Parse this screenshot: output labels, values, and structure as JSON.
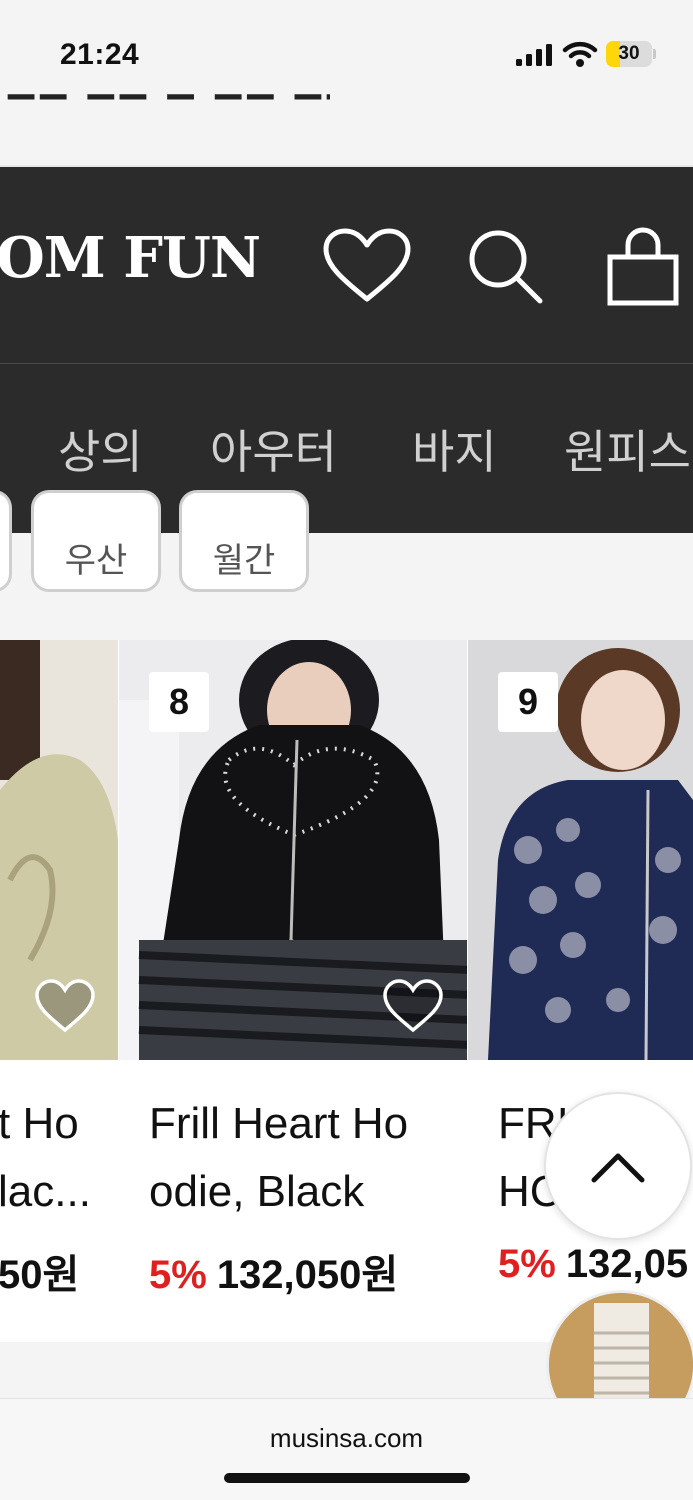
{
  "status_bar": {
    "time": "21:24",
    "battery_level": "30",
    "battery_fraction": 0.3,
    "icons": [
      "signal-icon",
      "wifi-icon",
      "battery-icon"
    ]
  },
  "header": {
    "brand": "OM FUN",
    "icons": [
      "heart-icon",
      "search-icon",
      "shopping-bag-icon"
    ]
  },
  "nav": {
    "items": [
      "상의",
      "아우터",
      "바지",
      "원피스"
    ]
  },
  "filter_chips": [
    "우산",
    "월간"
  ],
  "products": [
    {
      "name": "t Ho\nlac...",
      "discount": "",
      "price": "50원"
    },
    {
      "rank": "8",
      "name": "Frill Heart Ho\nodie, Black",
      "discount": "5%",
      "price": "132,050원"
    },
    {
      "rank": "9",
      "name": "FRI    D\nHC",
      "discount": "5%",
      "price": "132,05"
    }
  ],
  "browser": {
    "url": "musinsa.com"
  },
  "colors": {
    "header_bg": "#2b2b2b",
    "discount": "#e02020",
    "battery": "#ffd60a"
  }
}
